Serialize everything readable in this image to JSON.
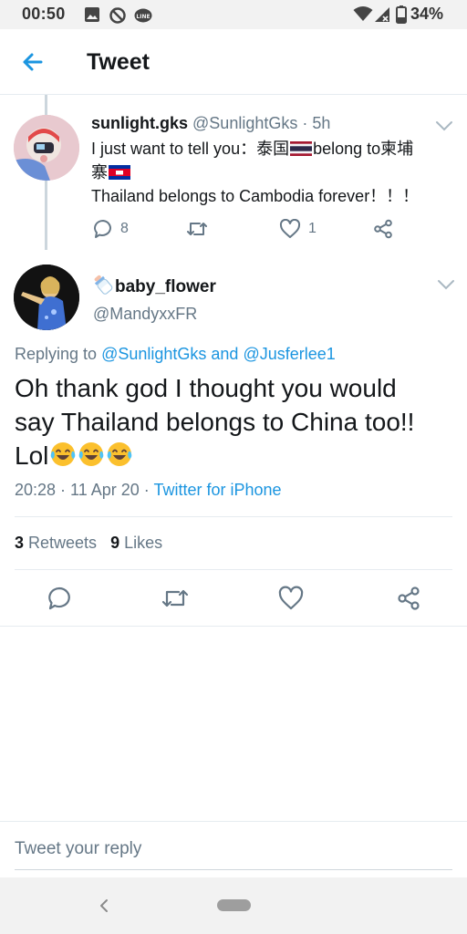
{
  "status_bar": {
    "time": "00:50",
    "battery": "34%",
    "icons": [
      "image-icon",
      "no-disturb-icon",
      "line-icon",
      "wifi-icon",
      "signal-icon",
      "battery-icon"
    ]
  },
  "header": {
    "title": "Tweet",
    "back_icon": "arrow-left-icon"
  },
  "parent_tweet": {
    "name": "sunlight.gks",
    "handle": "@SunlightGks",
    "time": "· 5h",
    "text_line1": "I just want to tell you：泰国",
    "text_line1b": "belong to柬埔",
    "text_line2": "寨",
    "text_line3": "Thailand belongs to Cambodia forever！！！",
    "replies": "8",
    "likes": "1"
  },
  "main_tweet": {
    "name": "baby_flower",
    "handle": "@MandyxxFR",
    "replying_prefix": "Replying to ",
    "replying_user1": "@SunlightGks",
    "replying_and": " and ",
    "replying_user2": "@Jusferlee1",
    "text_line1": "Oh thank god I thought you would",
    "text_line2": "say Thailand belongs to China too!!",
    "text_line3": "Lol",
    "timestamp": "20:28 · 11 Apr 20 · ",
    "source": "Twitter for iPhone",
    "retweet_count": "3",
    "retweet_label": " Retweets",
    "like_count": "9",
    "like_label": " Likes"
  },
  "reply_box": {
    "placeholder": "Tweet your reply"
  },
  "colors": {
    "accent": "#1b95e0",
    "secondary_text": "#657786",
    "divider": "#e6ecf0"
  }
}
